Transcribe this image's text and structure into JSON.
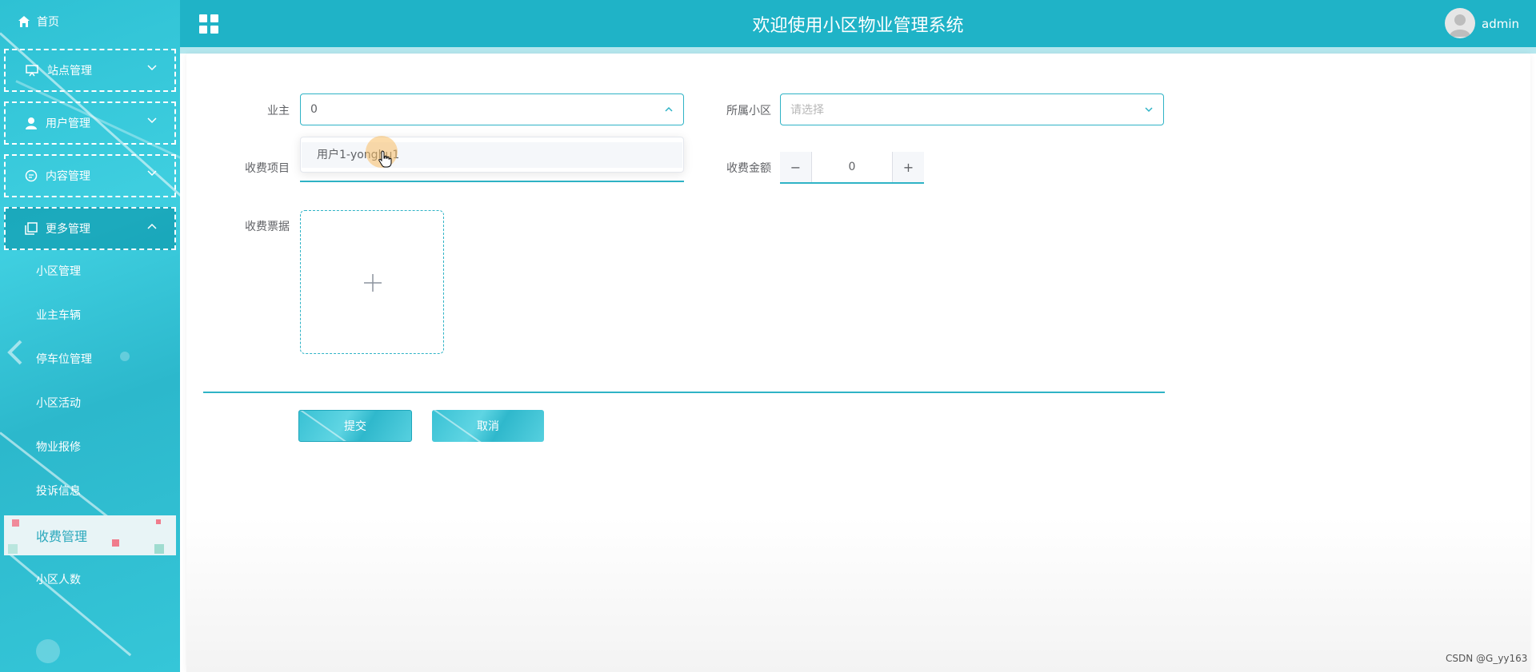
{
  "header": {
    "title": "欢迎使用小区物业管理系统",
    "user": "admin"
  },
  "sidebar": {
    "home": "首页",
    "groups": [
      {
        "label": "站点管理",
        "open": false
      },
      {
        "label": "用户管理",
        "open": false
      },
      {
        "label": "内容管理",
        "open": false
      },
      {
        "label": "更多管理",
        "open": true
      }
    ],
    "sub_items": [
      "小区管理",
      "业主车辆",
      "停车位管理",
      "小区活动",
      "物业报修",
      "投诉信息",
      "收费管理",
      "小区人数"
    ],
    "active_item": "收费管理"
  },
  "form": {
    "owner_label": "业主",
    "owner_value": "0",
    "owner_dropdown_option": "用户1-yonghu1",
    "community_label": "所属小区",
    "community_placeholder": "请选择",
    "fee_item_label": "收费项目",
    "fee_amount_label": "收费金额",
    "fee_amount_value": "0",
    "receipt_label": "收费票据",
    "submit_label": "提交",
    "cancel_label": "取消"
  },
  "watermark": "CSDN @G_yy163",
  "colors": {
    "accent": "#1fb3c7",
    "sidebar": "#35c6d8",
    "active_text": "#2aa8bc"
  }
}
